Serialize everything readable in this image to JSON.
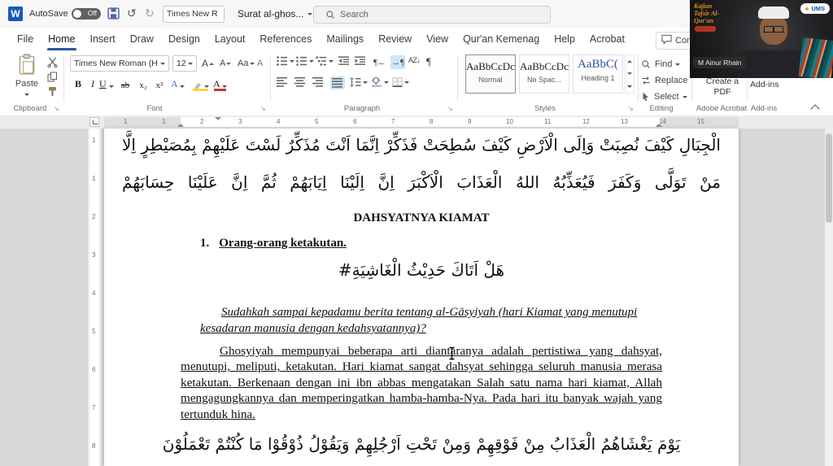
{
  "titlebar": {
    "word_logo": "W",
    "autosave_label": "AutoSave",
    "autosave_state": "Off",
    "undo_icon": "↺",
    "redo_icon": "↻",
    "quick_font": "Times New R",
    "doc_name": "Surat al-ghos...",
    "search_placeholder": "Search"
  },
  "menu": {
    "tabs": [
      "File",
      "Home",
      "Insert",
      "Draw",
      "Design",
      "Layout",
      "References",
      "Mailings",
      "Review",
      "View",
      "Qur'an Kemenag",
      "Help",
      "Acrobat"
    ],
    "comments_label": "Comm..."
  },
  "ribbon": {
    "clipboard": {
      "paste_label": "Paste",
      "group_label": "Clipboard"
    },
    "font": {
      "family": "Times New Roman (H",
      "size": "12",
      "grow": "A",
      "shrink": "A",
      "case_btn": "Aa",
      "clear": "A",
      "bold": "B",
      "italic": "I",
      "underline": "U",
      "strike": "ab",
      "subscript": "x₂",
      "superscript": "x²",
      "effects": "A",
      "color": "A",
      "group_label": "Font"
    },
    "paragraph": {
      "sort": "AZ↓",
      "pilcrow": "¶",
      "group_label": "Paragraph"
    },
    "styles": {
      "cards": [
        {
          "preview": "AaBbCcDc",
          "name": "Normal"
        },
        {
          "preview": "AaBbCcDc",
          "name": "No Spac..."
        },
        {
          "preview": "AaBbC(",
          "name": "Heading 1"
        }
      ],
      "group_label": "Styles"
    },
    "editing": {
      "find": "Find",
      "replace": "Replace",
      "select": "Select",
      "group_label": "Editing"
    },
    "acrobat": {
      "button": "Create a PDF",
      "group_label": "Adobe Acrobat"
    },
    "addins": {
      "button": "Add-ins",
      "group_label": "Add-ins"
    }
  },
  "ruler": {
    "h_numbers": [
      "1",
      "1",
      "2",
      "3",
      "4",
      "5",
      "6",
      "7",
      "8",
      "9",
      "10",
      "11",
      "12",
      "13",
      "14",
      "15"
    ],
    "v_numbers": [
      "1",
      "1",
      "2",
      "3",
      "4",
      "5",
      "6",
      "7",
      "8"
    ]
  },
  "document": {
    "arabic_line1": "الْجِبَالِ كَيْفَ نُصِبَتْ وَاِلَى الْاَرْضِ كَيْفَ سُطِحَتْ فَذَكِّرْ اِنَّمَا اَنْتَ مُذَكِّرٌ لَسْتَ عَلَيْهِمْ بِمُصَيْطِرٍ اِلَّا",
    "arabic_line2": "مَنْ تَوَلَّى وَكَفَرَ فَيُعَذِّبُهُ اللهُ الْعَذَابَ الْاَكْبَرَ اِنَّ اِلَيْنَا اِيَابَهُمْ ثُمَّ اِنَّ عَلَيْنَا حِسَابَهُمْ",
    "heading": "DAHSYATNYA KIAMAT",
    "list_number": "1.",
    "list_text": "Orang-orang ketakutan.",
    "arabic_verse": "#هَلْ اَتَاكَ حَدِيْثُ الْغَاشِيَةِ",
    "translation": "Sudahkah sampai kepadamu berita tentang al-Gāsyiyah (hari Kiamat yang menutupi kesadaran manusia dengan kedahsyatannya)?",
    "body_paragraph": "Ghosyiyah mempunyai beberapa arti diantaranya adalah pertistiwa yang dahsyat, menutupi, meliputi, ketakutan. Hari kiamat sangat dahsyat sehingga seluruh manusia merasa ketakutan. Berkenaan dengan ini ibn abbas mengatakan Salah satu nama hari kiamat, Allah mengagungkannya dan memperingatkan hamba-hamba-Nya.  Pada hari itu banyak wajah yang tertunduk hina.",
    "arabic_line3": "يَوْمَ يَغْشَاهُمُ الْعَذَابُ مِنْ فَوْقِهِمْ وَمِنْ تَحْتِ اَرْجُلِهِمْ وَيَقُوْلُ ذُوْقُوْا مَا كُنْتُمْ تَعْمَلُوْنَ"
  },
  "video": {
    "logo_lines": [
      "Kajian",
      "Tafsir Al-",
      "Qur'an"
    ],
    "badge": "UMS",
    "name": "M Ainur Rhain"
  },
  "colors": {
    "accent": "#2b579a",
    "heading_style_color": "#2f5496"
  }
}
